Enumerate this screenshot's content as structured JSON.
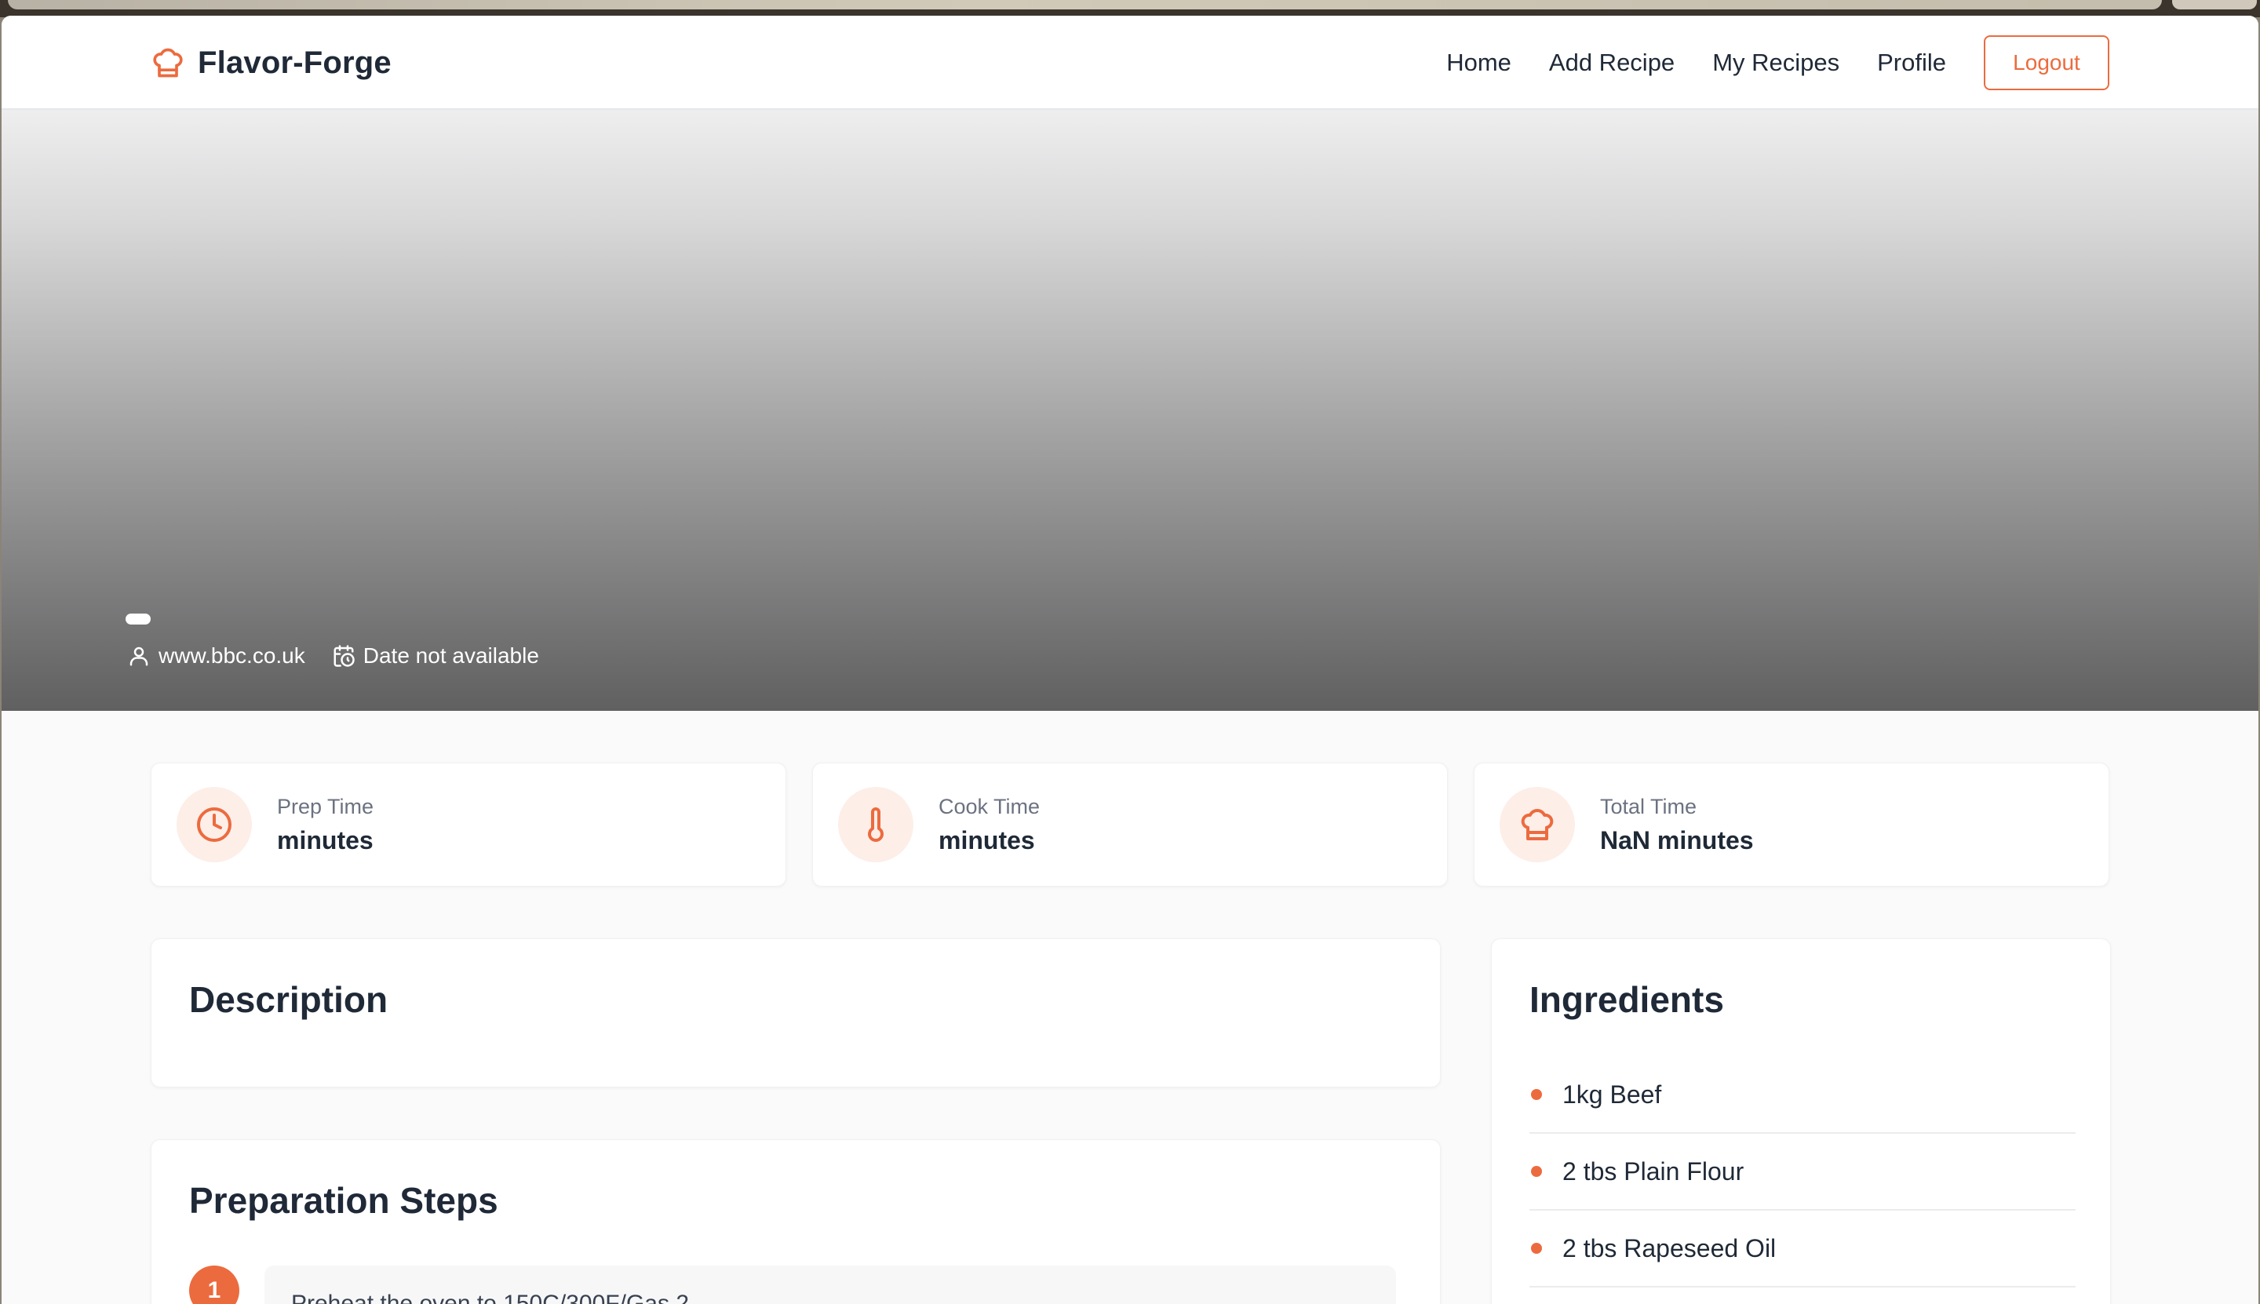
{
  "app": {
    "brand_name": "Flavor-Forge",
    "accent_color": "#ec6b3e"
  },
  "nav": {
    "links": [
      "Home",
      "Add Recipe",
      "My Recipes",
      "Profile"
    ],
    "logout_label": "Logout"
  },
  "hero": {
    "author": "www.bbc.co.uk",
    "date": "Date not available"
  },
  "stats": [
    {
      "label": "Prep Time",
      "value": "minutes",
      "icon": "clock-icon"
    },
    {
      "label": "Cook Time",
      "value": "minutes",
      "icon": "thermometer-icon"
    },
    {
      "label": "Total Time",
      "value": "NaN minutes",
      "icon": "chef-hat-icon"
    }
  ],
  "description": {
    "title": "Description",
    "text": ""
  },
  "steps": {
    "title": "Preparation Steps",
    "items": [
      {
        "number": "1",
        "text": "Preheat the oven to 150C/300F/Gas 2."
      }
    ]
  },
  "ingredients": {
    "title": "Ingredients",
    "items": [
      "1kg Beef",
      "2 tbs Plain Flour",
      "2 tbs Rapeseed Oil"
    ]
  }
}
